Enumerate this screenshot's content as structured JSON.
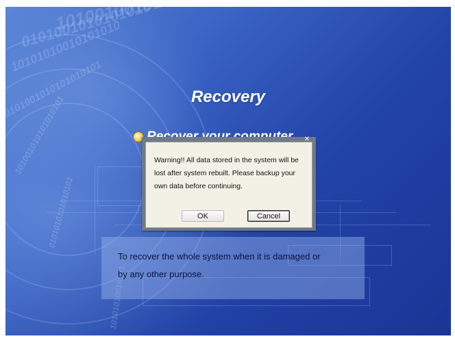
{
  "screen": {
    "title": "Recovery",
    "option": {
      "label": "Recover your computer"
    },
    "description": {
      "line1": "To recover the whole system when it is damaged or",
      "line2": "by any other purpose."
    }
  },
  "dialog": {
    "close_icon": "close-icon",
    "message_line1": "Warning!! All data stored in the system will be",
    "message_line2": "lost after system rebuilt. Please backup your",
    "message_line3": "own data before continuing.",
    "ok_label": "OK",
    "cancel_label": "Cancel"
  },
  "background": {
    "binary_rows": [
      "10100100101010",
      "0101001010101010",
      "10101010010101010",
      "0101001010101010101",
      "101001010101010101",
      "0101010101010101",
      "10101010010101"
    ]
  },
  "colors": {
    "background_deep": "#1a3596",
    "background_light": "#5b86d6",
    "dialog_frame": "#6f7a86",
    "dialog_body": "#f3f0e6",
    "description_panel": "#96b4eb"
  }
}
